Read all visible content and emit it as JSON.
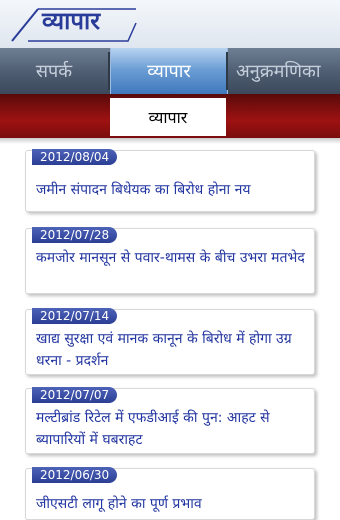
{
  "header": {
    "logo_text": "व्यापार"
  },
  "tabs": [
    {
      "label": "सपर्क"
    },
    {
      "label": "व्यापार"
    },
    {
      "label": "अनुक्रमणिका"
    }
  ],
  "section": {
    "title": "व्यापार"
  },
  "articles": [
    {
      "date": "2012/08/04",
      "headline": "जमीन संपादन बिधेयक का बिरोध होना नय"
    },
    {
      "date": "2012/07/28",
      "headline": "कमजोर मानसून से पवार-थामस के बीच उभरा मतभेद"
    },
    {
      "date": "2012/07/14",
      "headline": "खाद्य सुरक्षा एवं मानक कानून के बिरोध में होगा उग्र धरना - प्रदर्शन"
    },
    {
      "date": "2012/07/07",
      "headline": "मल्टीब्रांड रिटेल में एफडीआई की पुन: आहट से ब्यापारियों में घबराहट"
    },
    {
      "date": "2012/06/30",
      "headline": "जीएसटी लागू होने का पूर्ण प्रभाव"
    }
  ],
  "colors": {
    "accent_blue": "#2a3c9a",
    "tab_active": "#3f78bd",
    "red_band": "#9e1212"
  }
}
